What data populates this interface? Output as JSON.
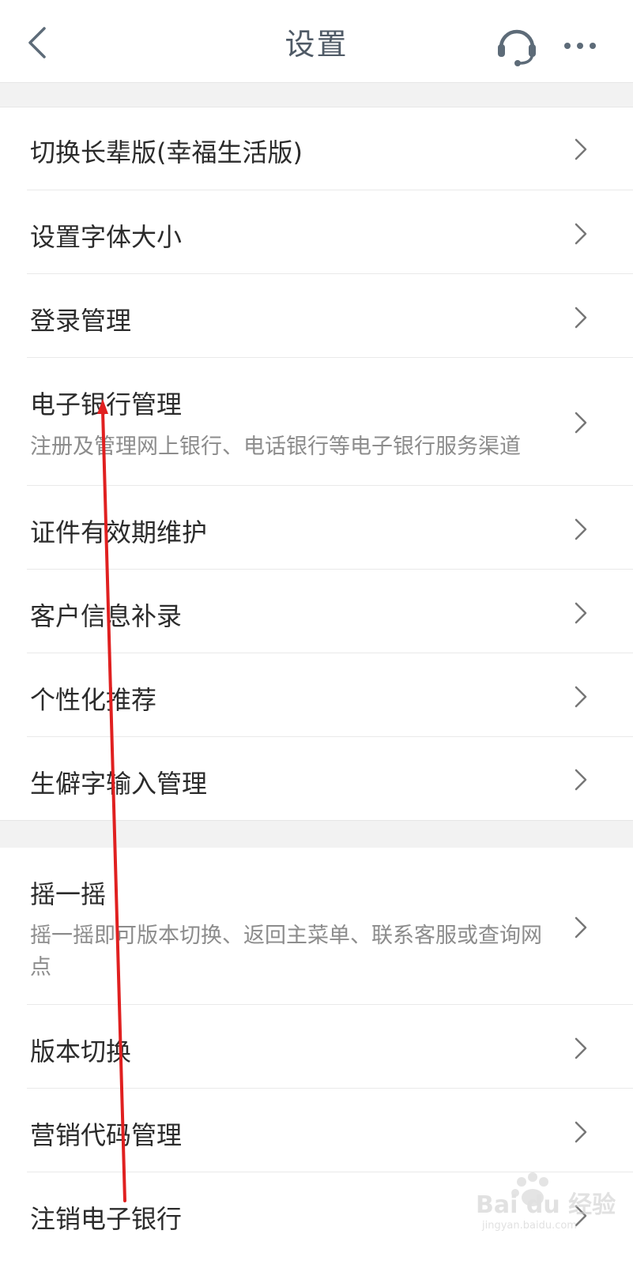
{
  "header": {
    "title": "设置"
  },
  "settings": {
    "group1": [
      {
        "label": "切换长辈版(幸福生活版)"
      },
      {
        "label": "设置字体大小"
      },
      {
        "label": "登录管理"
      },
      {
        "label": "电子银行管理",
        "description": "注册及管理网上银行、电话银行等电子银行服务渠道"
      },
      {
        "label": "证件有效期维护"
      },
      {
        "label": "客户信息补录"
      },
      {
        "label": "个性化推荐"
      },
      {
        "label": "生僻字输入管理"
      }
    ],
    "group2": [
      {
        "label": "摇一摇",
        "description": "摇一摇即可版本切换、返回主菜单、联系客服或查询网点"
      },
      {
        "label": "版本切换"
      },
      {
        "label": "营销代码管理"
      },
      {
        "label": "注销电子银行"
      }
    ]
  },
  "watermark": {
    "brand": "Bai du 经验",
    "url": "jingyan.baidu.com"
  },
  "colors": {
    "header_icon": "#5d6b78",
    "annotation_arrow": "#e02020"
  }
}
